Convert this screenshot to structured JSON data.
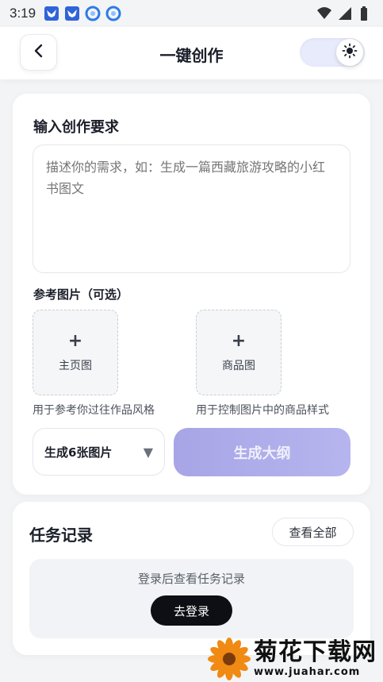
{
  "status_bar": {
    "time": "3:19",
    "icons_left": [
      "bird-app-icon",
      "bird-app-icon",
      "qq-browser-icon",
      "qq-browser-icon"
    ],
    "icons_right": [
      "wifi-icon",
      "signal-icon",
      "battery-icon"
    ]
  },
  "header": {
    "title": "一键创作",
    "back_icon": "chevron-left-icon",
    "theme_icon": "sun-icon"
  },
  "create": {
    "section_title": "输入创作要求",
    "textarea_placeholder": "描述你的需求，如：生成一篇西藏旅游攻略的小红书图文",
    "ref_title": "参考图片（可选）",
    "uploads": [
      {
        "plus": "+",
        "label": "主页图",
        "hint": "用于参考你过往作品风格"
      },
      {
        "plus": "+",
        "label": "商品图",
        "hint": "用于控制图片中的商品样式"
      }
    ],
    "count_select": {
      "value": "生成6张图片",
      "arrow": "▼"
    },
    "generate_label": "生成大纲"
  },
  "tasks": {
    "title": "任务记录",
    "view_all": "查看全部",
    "empty_text": "登录后查看任务记录",
    "login_label": "去登录"
  },
  "watermark": {
    "name": "菊花下载网",
    "url": "www.juahar.com"
  },
  "colors": {
    "accent": "#a8a5e6",
    "background": "#f3f4f6",
    "login_button": "#0d0f14"
  }
}
